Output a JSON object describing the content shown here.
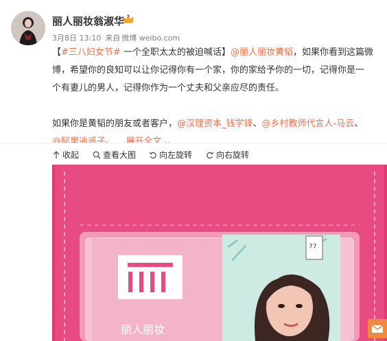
{
  "user": {
    "name": "丽人丽妆翁淑华",
    "date": "3月8日 13:10",
    "source_prefix": "来自",
    "source": "微博 weibo.com"
  },
  "post": {
    "bracket_open": "【",
    "hashtag": "#三八妇女节#",
    "title_text": " 一个全职太太的被迫喊话】",
    "mention1": "@丽人丽妆黄韬",
    "line1_tail": "，如果你看到这篇微",
    "line2": "博，希望你的良知可以让你记得你有一个家，你的家给予你的一切，记得你是一",
    "line3": "个有妻儿的男人，记得你作为一个丈夫和父亲应尽的责任。",
    "line4_text": "如果你是黄韬的朋友或者客户，",
    "mention2": "@汉理资本_钱学锋",
    "sep1": "、",
    "mention3": "@乡村教师代言人-马云",
    "sep2": "、",
    "mention4": "@阿里逍遥子",
    "sep3": "、 ...",
    "expand": "展开全文",
    "expand_arrow": "⌄"
  },
  "toolbar": {
    "collapse": "收起",
    "view_large": "查看大图",
    "rotate_left": "向左旋转",
    "rotate_right": "向右旋转"
  },
  "photo": {
    "card_brand": "丽人丽妆",
    "tag_number": "77"
  },
  "colors": {
    "accent": "#eb7350",
    "wallet_pink": "#e63a77",
    "card_pink": "#f3b4c9"
  },
  "icons": [
    "vip-crown-icon",
    "collapse-arrow-icon",
    "zoom-icon",
    "rotate-left-icon",
    "rotate-right-icon",
    "mail-icon"
  ]
}
